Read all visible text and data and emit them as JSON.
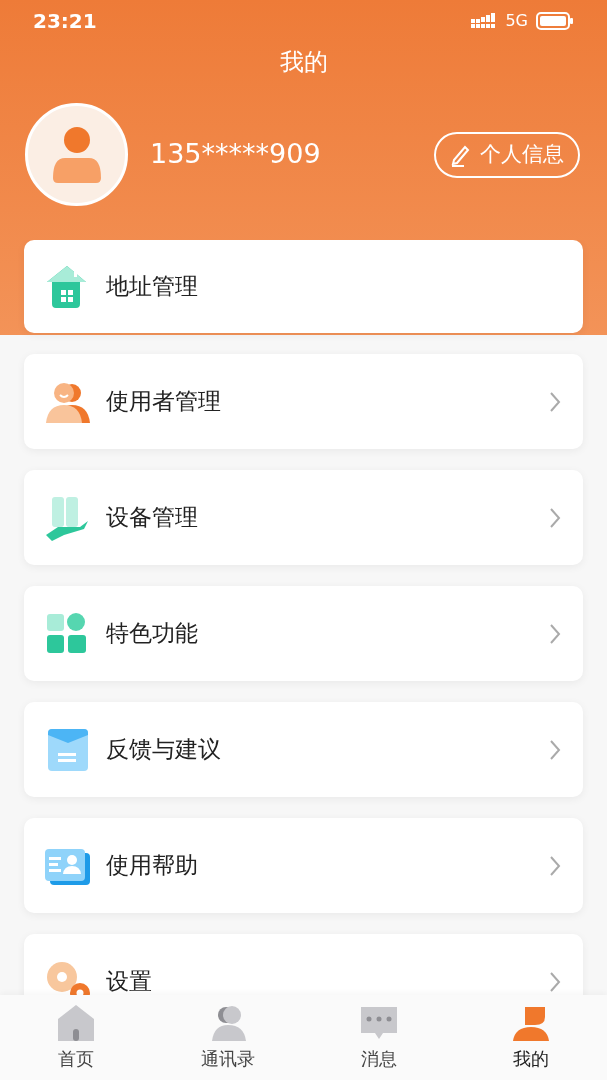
{
  "status_bar": {
    "time": "23:21",
    "network": "5G"
  },
  "title": "我的",
  "profile": {
    "phone": "135*****909",
    "edit_button": "个人信息"
  },
  "menu": [
    {
      "label": "地址管理",
      "chevron": false
    },
    {
      "label": "使用者管理",
      "chevron": true
    },
    {
      "label": "设备管理",
      "chevron": true
    },
    {
      "label": "特色功能",
      "chevron": true
    },
    {
      "label": "反馈与建议",
      "chevron": true
    },
    {
      "label": "使用帮助",
      "chevron": true
    },
    {
      "label": "设置",
      "chevron": true
    }
  ],
  "tab_bar": [
    {
      "label": "首页",
      "selected": false
    },
    {
      "label": "通讯录",
      "selected": false
    },
    {
      "label": "消息",
      "selected": false
    },
    {
      "label": "我的",
      "selected": true
    }
  ]
}
